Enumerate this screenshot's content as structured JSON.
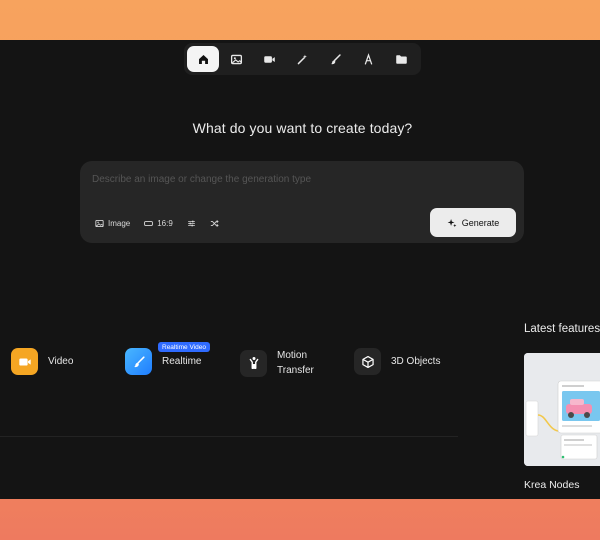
{
  "nav": {
    "items": [
      {
        "icon": "home-icon",
        "active": true
      },
      {
        "icon": "image-icon",
        "active": false
      },
      {
        "icon": "video-icon",
        "active": false
      },
      {
        "icon": "magic-wand-icon",
        "active": false
      },
      {
        "icon": "brush-icon",
        "active": false
      },
      {
        "icon": "font-icon",
        "active": false
      },
      {
        "icon": "folder-icon",
        "active": false
      }
    ]
  },
  "heading": "What do you want to create today?",
  "prompt": {
    "placeholder": "Describe an image or change the generation type",
    "value": "",
    "mode_label": "Image",
    "aspect_label": "16:9",
    "generate_label": "Generate"
  },
  "tools": [
    {
      "id": "video",
      "label": "Video",
      "icon": "video-icon",
      "color": "#f5a623"
    },
    {
      "id": "realtime",
      "label": "Realtime",
      "icon": "brush-icon",
      "color": "#3aa0ff",
      "badge": "Realtime Video"
    },
    {
      "id": "motion-transfer",
      "label": "Motion Transfer",
      "icon": "figure-icon",
      "color": "#2a2a2a"
    },
    {
      "id": "3d-objects",
      "label": "3D Objects",
      "icon": "cube-icon",
      "color": "#2a2a2a"
    }
  ],
  "latest": {
    "title": "Latest features",
    "feature_name": "Krea Nodes"
  },
  "colors": {
    "background": "#141414",
    "accent": "#2f6bff",
    "frame": "#f59a5a"
  }
}
